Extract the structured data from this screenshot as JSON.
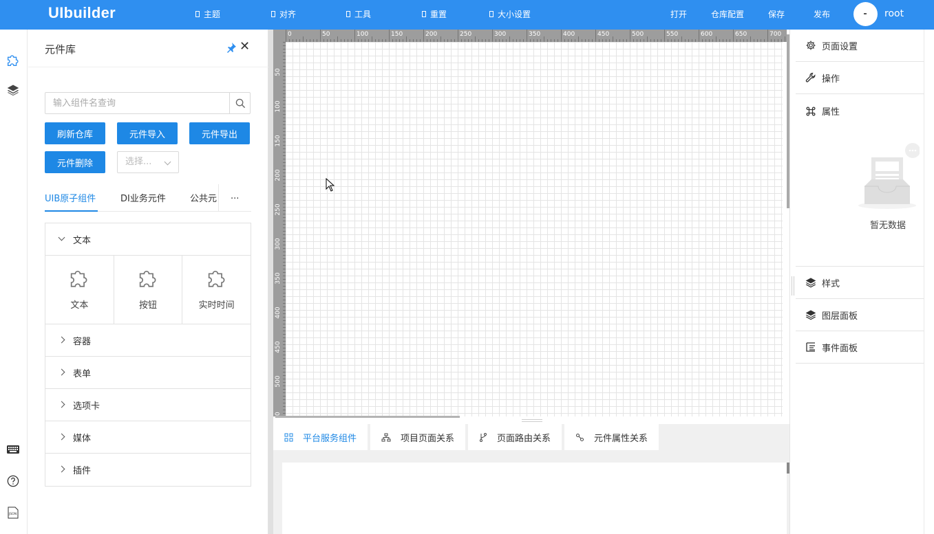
{
  "header": {
    "logo": "UIbuilder",
    "menu": [
      {
        "label": "主题"
      },
      {
        "label": "对齐"
      },
      {
        "label": "工具"
      },
      {
        "label": "重置"
      },
      {
        "label": "大小设置"
      }
    ],
    "actions": {
      "open": "打开",
      "repo_config": "仓库配置",
      "save": "保存",
      "publish": "发布"
    },
    "user": "root",
    "color": "#2f8ff0"
  },
  "library": {
    "title": "元件库",
    "search": {
      "placeholder": "输入组件名查询",
      "value": ""
    },
    "buttons": {
      "refresh": "刷新仓库",
      "import": "元件导入",
      "export": "元件导出",
      "delete": "元件删除"
    },
    "select": {
      "placeholder": "选择..."
    },
    "tabs": [
      {
        "label": "UIB原子组件",
        "active": true
      },
      {
        "label": "DI业务元件"
      },
      {
        "label": "公共元"
      }
    ],
    "tabs_more": "...",
    "groups": [
      {
        "label": "文本",
        "open": true,
        "items": [
          "文本",
          "按钮",
          "实时时间"
        ]
      },
      {
        "label": "容器"
      },
      {
        "label": "表单"
      },
      {
        "label": "选项卡"
      },
      {
        "label": "媒体"
      },
      {
        "label": "插件"
      }
    ]
  },
  "canvas": {
    "ruler_top": [
      "0",
      "50",
      "100",
      "150",
      "200",
      "250",
      "300",
      "350",
      "400",
      "450",
      "500",
      "550",
      "600",
      "650",
      "700"
    ],
    "ruler_left": [
      "50",
      "100",
      "150",
      "200",
      "250",
      "300",
      "350",
      "400",
      "450",
      "500",
      "50"
    ]
  },
  "bottom": {
    "tabs": [
      {
        "label": "平台服务组件",
        "active": true,
        "icon": "grid-icon"
      },
      {
        "label": "项目页面关系",
        "icon": "sitemap-icon"
      },
      {
        "label": "页面路由关系",
        "icon": "branch-icon"
      },
      {
        "label": "元件属性关系",
        "icon": "link-icon"
      }
    ]
  },
  "right": {
    "page_settings": "页面设置",
    "operation": "操作",
    "properties": "属性",
    "empty": "暂无数据",
    "style": "样式",
    "layers": "图层面板",
    "events": "事件面板"
  }
}
